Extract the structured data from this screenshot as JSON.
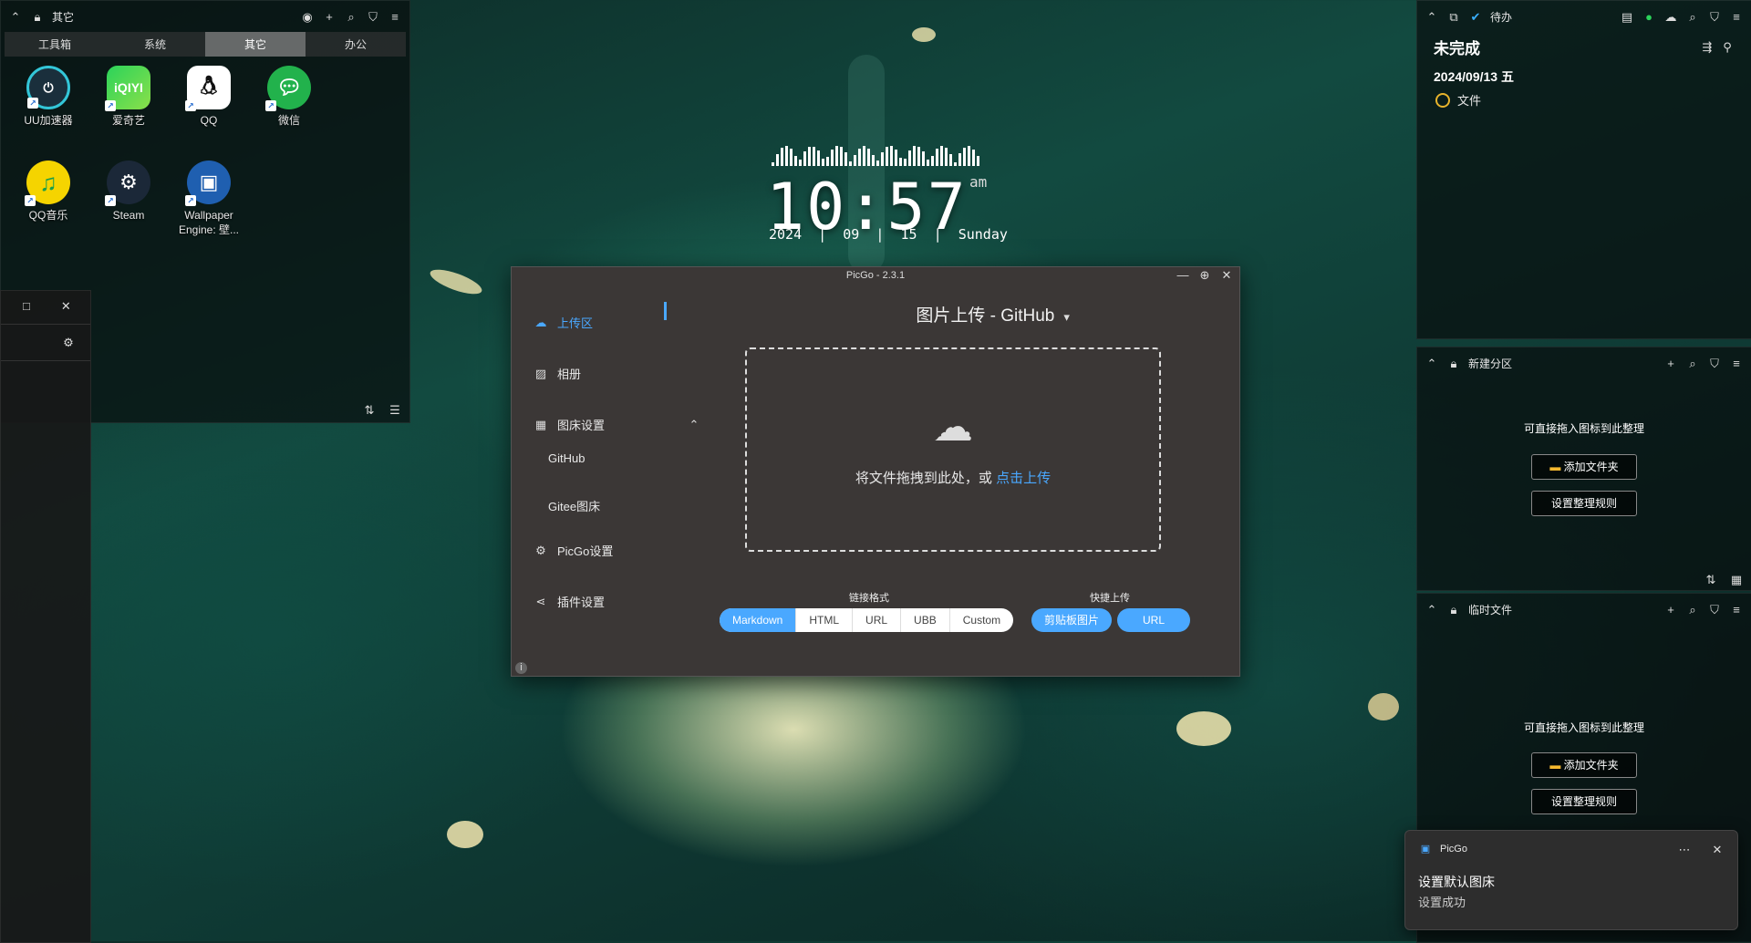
{
  "left_panel": {
    "title": "其它",
    "tabs": [
      "工具箱",
      "系统",
      "其它",
      "办公"
    ],
    "active_tab": 2,
    "icons": [
      {
        "label": "UU加速器",
        "icon": "uu-accelerator-icon",
        "color": "#1a2f3c"
      },
      {
        "label": "爱奇艺",
        "icon": "iqiyi-icon",
        "color": "#1fbf4a",
        "text": "iQIYI"
      },
      {
        "label": "QQ",
        "icon": "qq-icon",
        "color": "#ffffff"
      },
      {
        "label": "微信",
        "icon": "wechat-icon",
        "color": "#22b24c"
      },
      {
        "label": "QQ音乐",
        "icon": "qq-music-icon",
        "color": "#f5d400"
      },
      {
        "label": "Steam",
        "icon": "steam-icon",
        "color": "#1b2838"
      },
      {
        "label": "Wallpaper Engine: 壁...",
        "icon": "wallpaper-engine-icon",
        "color": "#1f5fb0"
      }
    ]
  },
  "clock": {
    "time": "10:57",
    "ampm": "am",
    "date": "2024  |  09  |  15  |  Sunday"
  },
  "picgo": {
    "window_title": "PicGo - 2.3.1",
    "menu": {
      "upload": "上传区",
      "album": "相册",
      "bed_settings": "图床设置",
      "github": "GitHub",
      "gitee": "Gitee图床",
      "picgo_settings": "PicGo设置",
      "plugin_settings": "插件设置"
    },
    "upload_title": "图片上传 - GitHub",
    "drop_text": "将文件拖拽到此处，或 ",
    "drop_link": "点击上传",
    "link_format_label": "链接格式",
    "link_formats": [
      "Markdown",
      "HTML",
      "URL",
      "UBB",
      "Custom"
    ],
    "active_format": "Markdown",
    "quick_upload_label": "快捷上传",
    "quick_buttons": [
      "剪贴板图片",
      "URL"
    ],
    "accent": "#4aa8ff"
  },
  "todo_panel": {
    "title": "待办",
    "heading": "未完成",
    "date": "2024/09/13 五",
    "items": [
      "文件"
    ]
  },
  "new_partition": {
    "title": "新建分区",
    "hint": "可直接拖入图标到此整理",
    "add_folder": "添加文件夹",
    "set_rules": "设置整理规则"
  },
  "temp_files": {
    "title": "临时文件",
    "hint": "可直接拖入图标到此整理",
    "add_folder": "添加文件夹",
    "set_rules": "设置整理规则"
  },
  "notification": {
    "app": "PicGo",
    "title": "设置默认图床",
    "body": "设置成功"
  }
}
